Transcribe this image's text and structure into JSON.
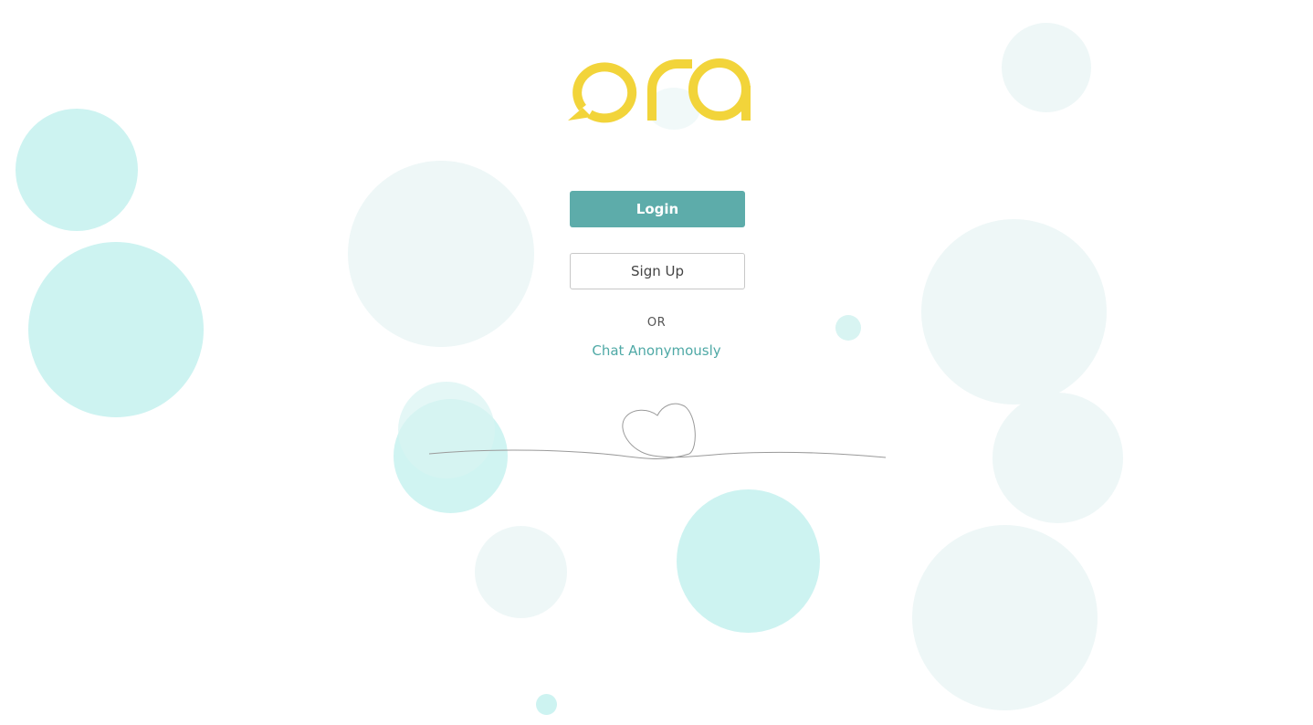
{
  "brand": {
    "name": "ora",
    "logo_color": "#f2d43a"
  },
  "auth": {
    "login_label": "Login",
    "signup_label": "Sign Up",
    "divider_label": "OR",
    "anonymous_label": "Chat Anonymously"
  },
  "colors": {
    "primary": "#5dacaa",
    "link": "#4fa9a6",
    "bubble": "#cdf3f1",
    "bubble_soft": "#eef7f7"
  }
}
